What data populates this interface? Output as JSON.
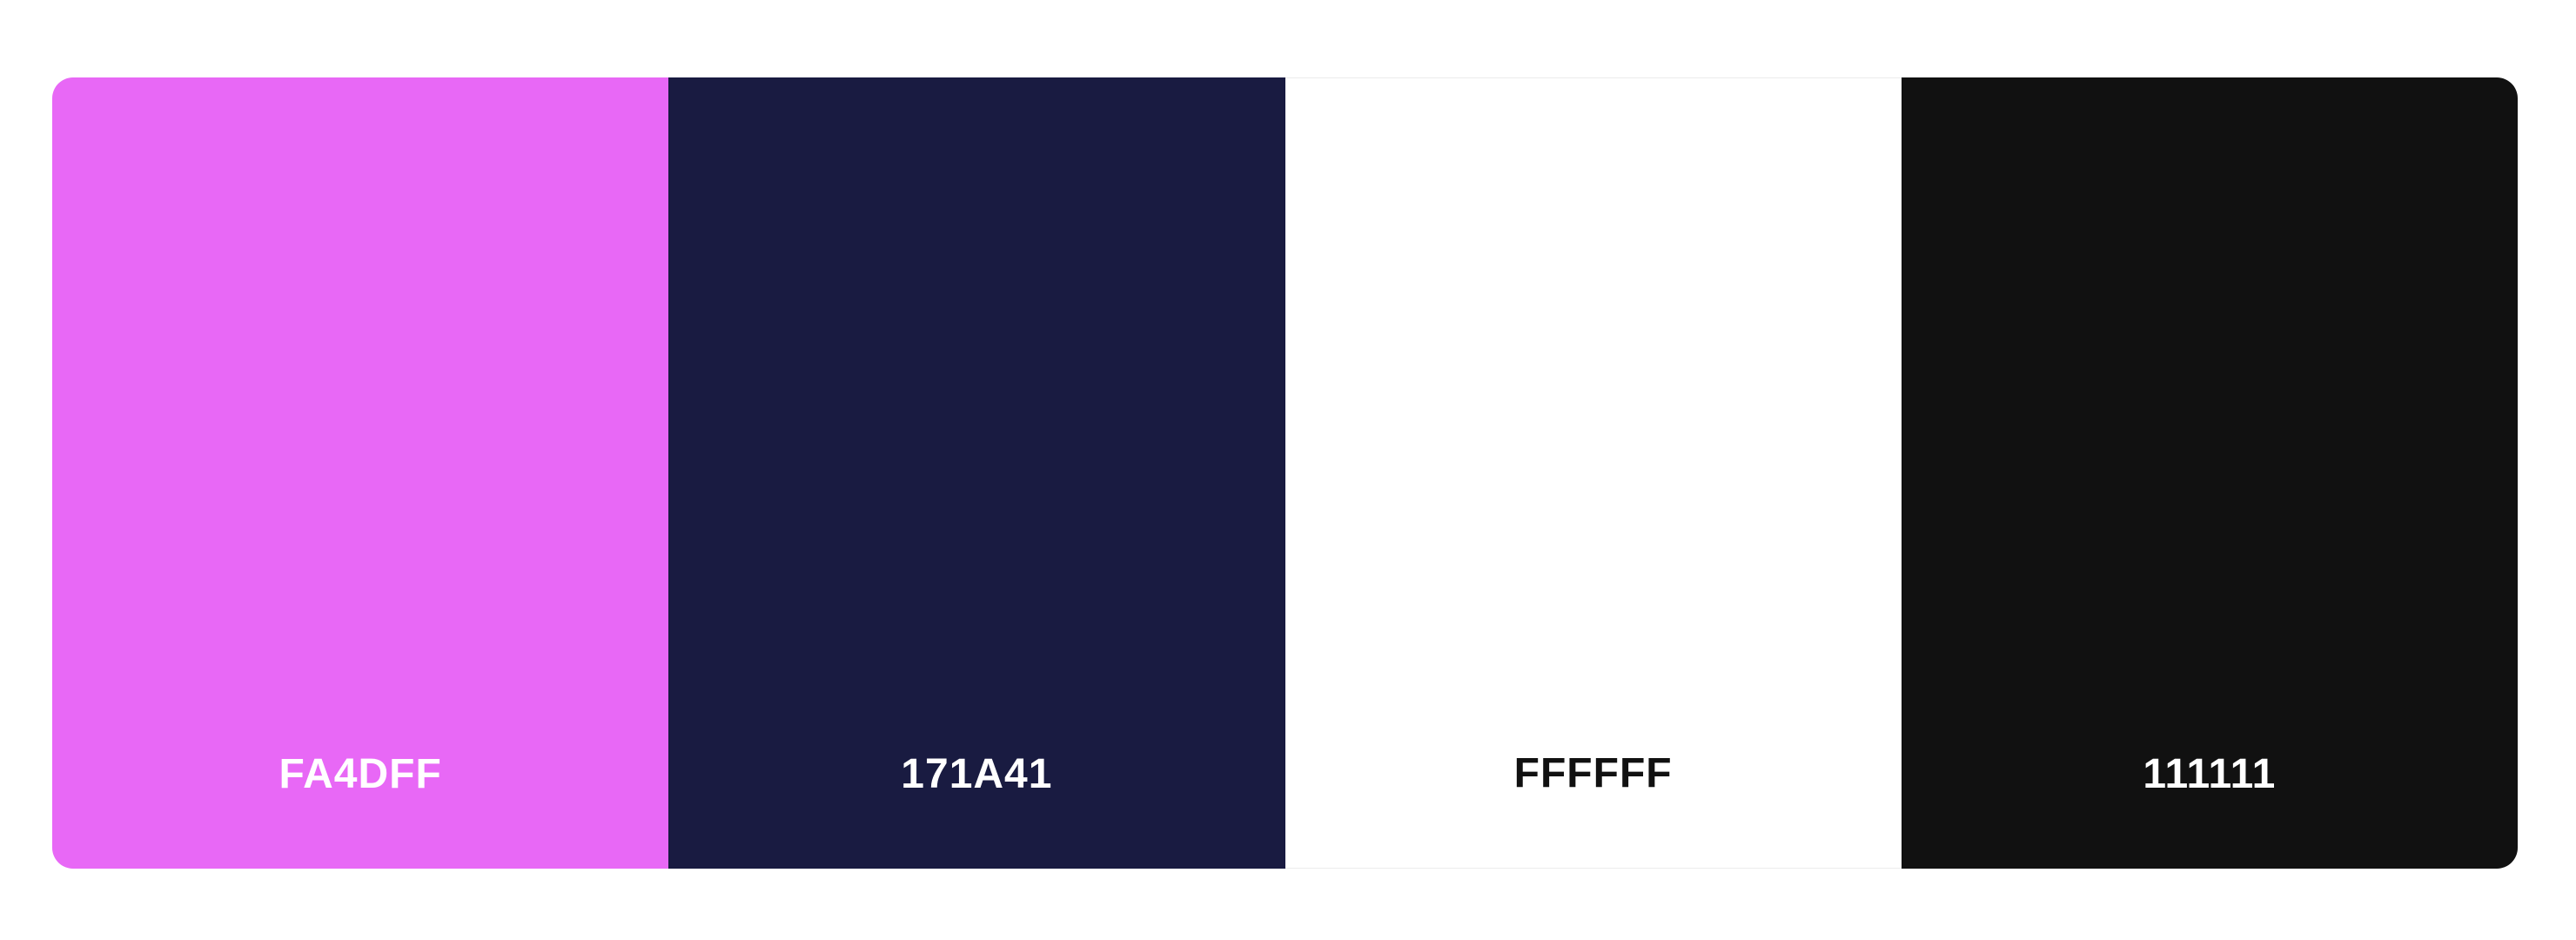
{
  "palette": {
    "swatches": [
      {
        "hex": "FA4DFF",
        "color": "#E868F6",
        "text_color": "#FFFFFF"
      },
      {
        "hex": "171A41",
        "color": "#191B41",
        "text_color": "#FFFFFF"
      },
      {
        "hex": "FFFFFF",
        "color": "#FFFFFF",
        "text_color": "#111111"
      },
      {
        "hex": "111111",
        "color": "#111111",
        "text_color": "#FFFFFF"
      }
    ]
  }
}
